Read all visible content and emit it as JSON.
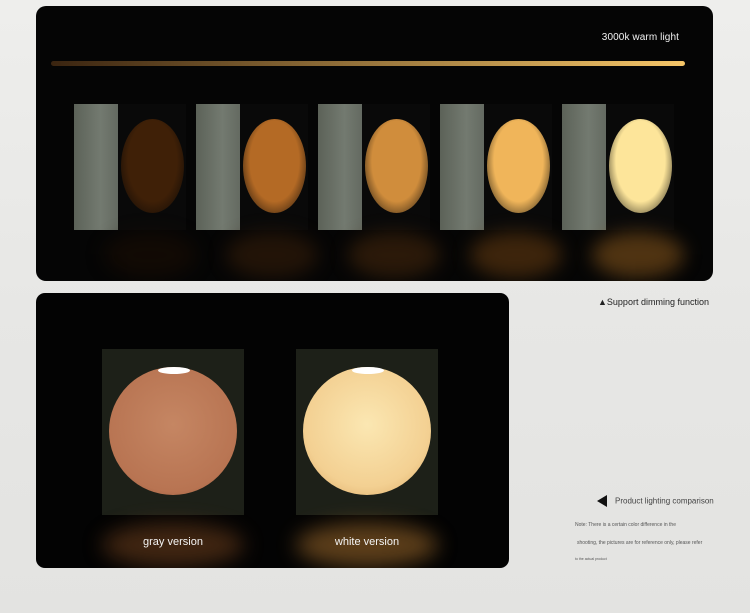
{
  "top_panel": {
    "label": "3000k warm light",
    "lamps": [
      {
        "name": "level-1",
        "color": "#3f2007",
        "floor": "#1c0e04"
      },
      {
        "name": "level-2",
        "color": "#b46a25",
        "floor": "#3a200a"
      },
      {
        "name": "level-3",
        "color": "#d08d3c",
        "floor": "#4a2a0d"
      },
      {
        "name": "level-4",
        "color": "#f0b55a",
        "floor": "#6b3f12"
      },
      {
        "name": "level-5",
        "color": "#fde59a",
        "floor": "#8d5a1d"
      }
    ]
  },
  "bottom_panel": {
    "gray_label": "gray version",
    "white_label": "white version"
  },
  "side": {
    "dimming": "Support dimming function",
    "comparison": "Product lighting comparison",
    "note_lines": [
      "Note: There is a certain color difference in the",
      "shooting, the pictures are for reference only, please refer",
      "to the actual product"
    ]
  },
  "colors": {
    "gradient_start": "#3a2410",
    "gradient_end": "#f6c668",
    "gray_disc": "#c58663",
    "white_disc": "#f3d092"
  }
}
